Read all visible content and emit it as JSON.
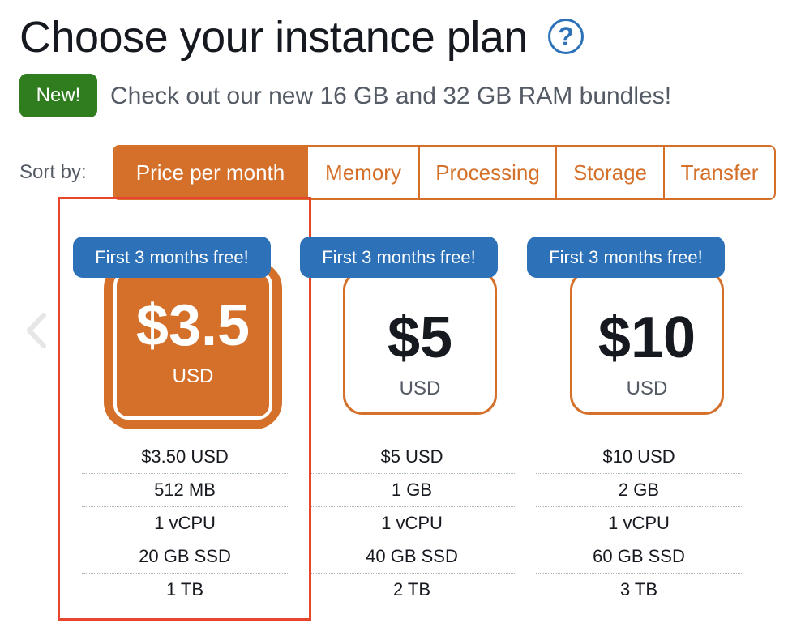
{
  "page": {
    "title": "Choose your instance plan",
    "help_icon": "question-mark",
    "new_badge": "New!",
    "announcement": "Check out our new 16 GB and 32 GB RAM bundles!",
    "sort_label": "Sort by:"
  },
  "sort_tabs": [
    {
      "label": "Price per month",
      "active": true
    },
    {
      "label": "Memory",
      "active": false
    },
    {
      "label": "Processing",
      "active": false
    },
    {
      "label": "Storage",
      "active": false
    },
    {
      "label": "Transfer",
      "active": false
    }
  ],
  "plans": [
    {
      "badge": "First 3 months free!",
      "price": "$3.5",
      "currency": "USD",
      "selected": true,
      "specs": [
        "$3.50 USD",
        "512 MB",
        "1 vCPU",
        "20 GB SSD",
        "1 TB"
      ]
    },
    {
      "badge": "First 3 months free!",
      "price": "$5",
      "currency": "USD",
      "selected": false,
      "specs": [
        "$5 USD",
        "1 GB",
        "1 vCPU",
        "40 GB SSD",
        "2 TB"
      ]
    },
    {
      "badge": "First 3 months free!",
      "price": "$10",
      "currency": "USD",
      "selected": false,
      "specs": [
        "$10 USD",
        "2 GB",
        "1 vCPU",
        "60 GB SSD",
        "3 TB"
      ]
    }
  ],
  "colors": {
    "accent": "#d4702a",
    "badge_blue": "#2d72b8",
    "new_green": "#2f7d1e",
    "highlight_red": "#e8452f"
  }
}
